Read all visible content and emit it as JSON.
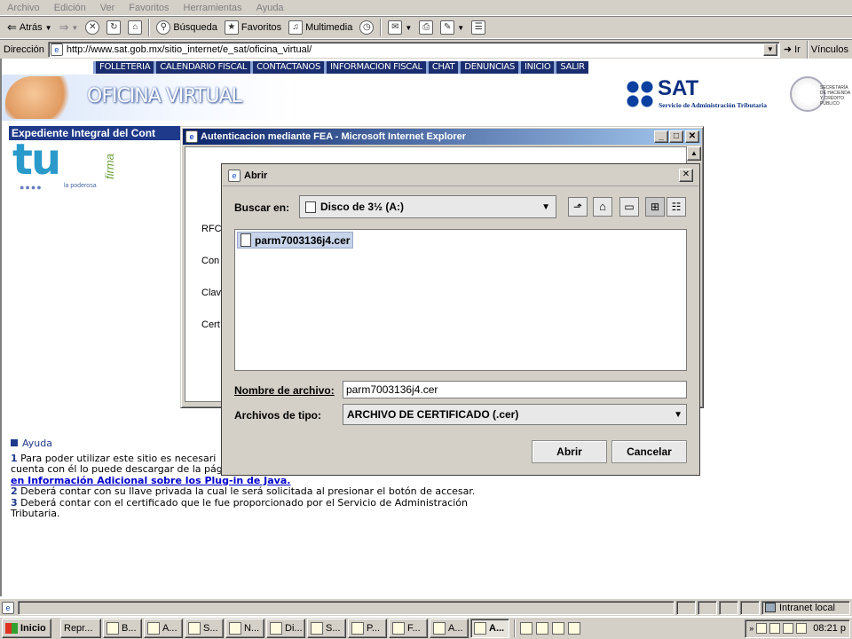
{
  "menu": [
    "Archivo",
    "Edición",
    "Ver",
    "Favoritos",
    "Herramientas",
    "Ayuda"
  ],
  "toolbar": {
    "back": "Atrás",
    "search": "Búsqueda",
    "favorites": "Favoritos",
    "multimedia": "Multimedia"
  },
  "address": {
    "label": "Dirección",
    "url": "http://www.sat.gob.mx/sitio_internet/e_sat/oficina_virtual/",
    "go": "Ir",
    "links": "Vínculos"
  },
  "nav": [
    "FOLLETERIA",
    "CALENDARIO FISCAL",
    "CONTACTANOS",
    "INFORMACION FISCAL",
    "CHAT",
    "DENUNCIAS",
    "INICIO",
    "SALIR"
  ],
  "page": {
    "banner_title": "OFICINA VIRTUAL",
    "sat_logo": "SAT",
    "sat_subtitle": "Servicio de Administración Tributaria",
    "shcp": "SECRETARÍA DE HACIENDA Y CRÉDITO PÚBLICO",
    "section_title": "Expediente Integral del Cont",
    "tu_logo": "tu",
    "tu_firma": "firma",
    "tu_tagline": "la poderosa",
    "help": {
      "title": "Ayuda",
      "item1_num": "1",
      "item1_text": "Para poder utilizar este sitio es necesari",
      "item1_text2": "cuenta con él lo puede descargar de la pág",
      "item1_link": "en Información Adicional sobre los Plug-in de Java.",
      "item2_num": "2",
      "item2_text": "Deberá contar con su llave privada la cual le será solicitada al presionar el botón de accesar.",
      "item3_num": "3",
      "item3_text": "Deberá contar con el certificado que le fue proporcionado por el Servicio de Administración",
      "item3_text2": "Tributaria."
    }
  },
  "fea_window": {
    "title": "Autenticacion mediante FEA - Microsoft Internet Explorer",
    "labels": [
      "RFC",
      "Con",
      "Clav",
      "Cert"
    ]
  },
  "dialog": {
    "title": "Abrir",
    "lookin_label": "Buscar en:",
    "lookin_value": "Disco de 3½ (A:)",
    "files": [
      "parm7003136j4.cer"
    ],
    "filename_label": "Nombre de archivo:",
    "filename_value": "parm7003136j4.cer",
    "filetype_label": "Archivos de tipo:",
    "filetype_value": "ARCHIVO DE CERTIFICADO (.cer)",
    "open_button": "Abrir",
    "cancel_button": "Cancelar"
  },
  "statusbar": {
    "zone": "Intranet local"
  },
  "taskbar": {
    "start": "Inicio",
    "tasks": [
      "Repr...",
      "B...",
      "A...",
      "S...",
      "N...",
      "Di...",
      "S...",
      "P...",
      "F...",
      "A...",
      "A..."
    ],
    "clock": "08:21 p"
  },
  "colors": {
    "titlebar_start": "#0a246a",
    "titlebar_end": "#a6caf0",
    "nav_bg": "#1a2d6e",
    "section_header": "#1f3a8a",
    "link": "#0000cc"
  }
}
